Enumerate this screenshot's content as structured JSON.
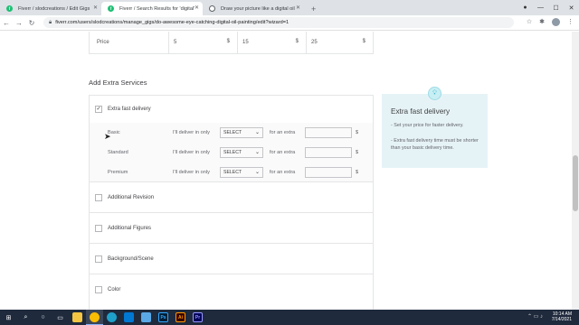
{
  "browser": {
    "tabs": [
      {
        "title": "Fiverr / slodcreations / Edit Gigs",
        "favicon": "fiverr-icon"
      },
      {
        "title": "Fiverr / Search Results for 'digital'",
        "favicon": "fiverr-icon"
      },
      {
        "title": "Draw your picture like a digital oil",
        "favicon": "globe-icon"
      }
    ],
    "new_tab": "+",
    "url": "fiverr.com/users/slodcreations/manage_gigs/do-awesome-eye-catching-digital-oil-painting/edit?wizard=1"
  },
  "pricing": {
    "label": "Price",
    "values": [
      "5",
      "15",
      "25"
    ],
    "currency": "$"
  },
  "extras": {
    "section_title": "Add Extra Services",
    "fast_delivery": {
      "label": "Extra fast delivery",
      "checked": true,
      "deliver_text": "I'll deliver in only",
      "for_extra_text": "for an extra",
      "select_placeholder": "SELECT",
      "currency": "$",
      "levels": [
        "Basic",
        "Standard",
        "Premium"
      ]
    },
    "options": [
      {
        "label": "Additional Revision"
      },
      {
        "label": "Additional Figures"
      },
      {
        "label": "Background/Scene"
      },
      {
        "label": "Color"
      }
    ]
  },
  "tip": {
    "title": "Extra fast delivery",
    "line1": "- Set your price for faster delivery.",
    "line2": "- Extra fast delivery time must be shorter than your basic delivery time."
  },
  "taskbar": {
    "time": "10:14 AM",
    "date": "7/14/2021"
  },
  "colors": {
    "fiverr_green": "#1dbf73",
    "tip_bg": "#e6f3f6",
    "taskbar_bg": "#1f2a3d"
  }
}
